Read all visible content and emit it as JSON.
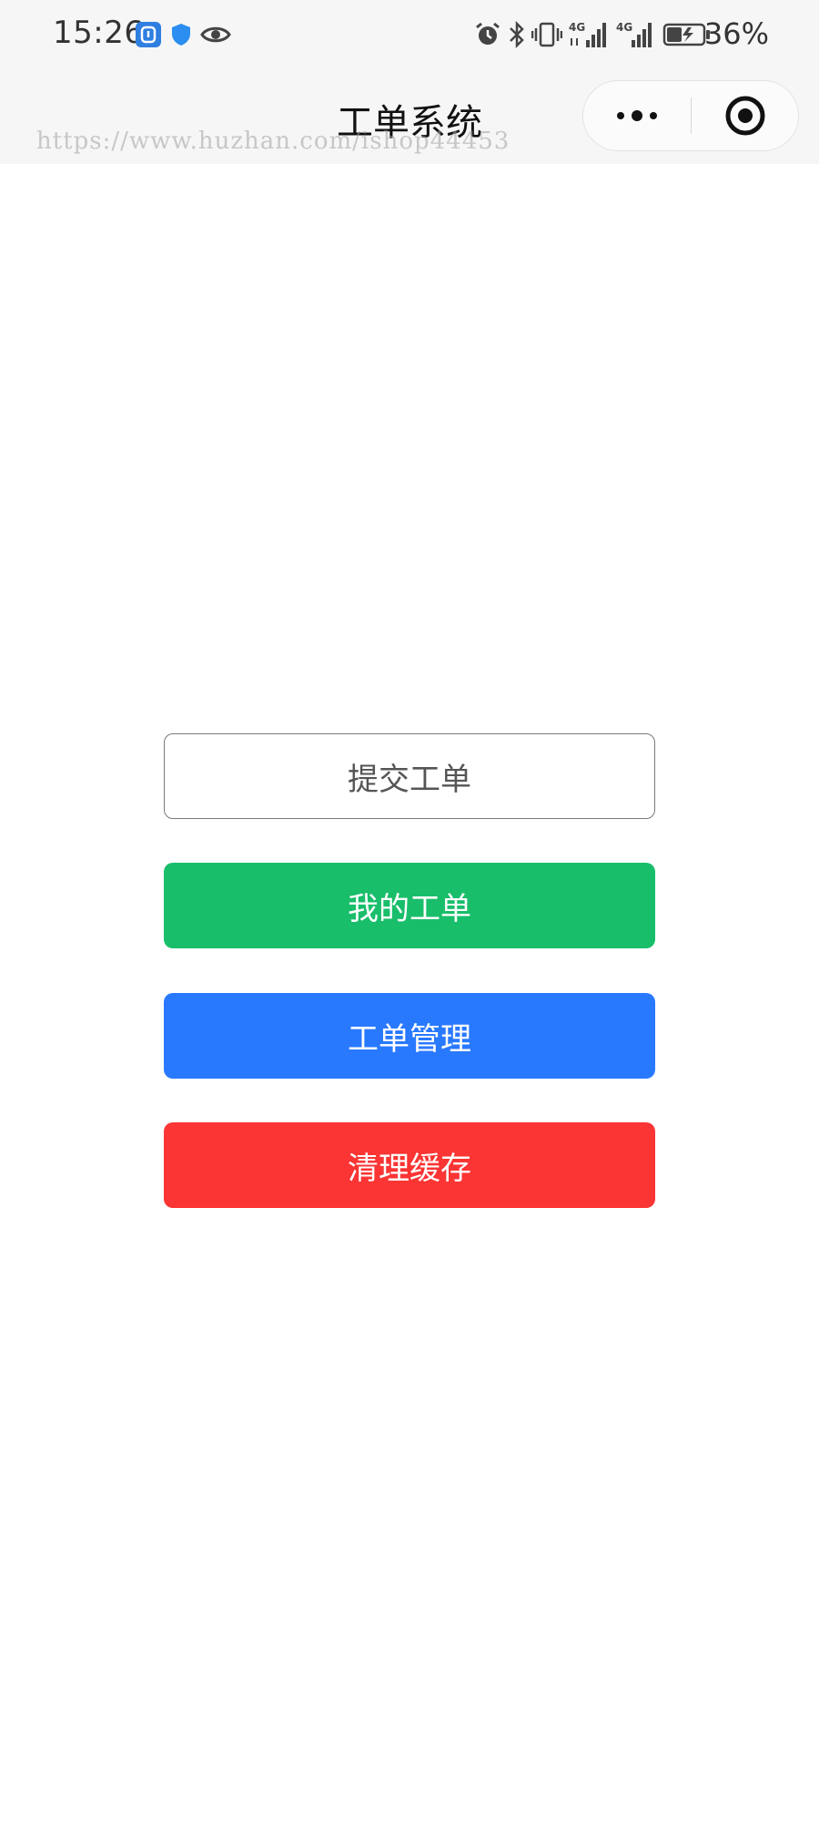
{
  "status_bar": {
    "time": "15:26",
    "battery_percent": "36%",
    "network_4g_1": "4G",
    "network_4g_2": "4G",
    "icons": [
      "app-notification-icon",
      "shield-icon",
      "eye-icon",
      "alarm-icon",
      "bluetooth-icon",
      "vibrate-icon",
      "signal-4g-icon",
      "signal-4g-icon",
      "battery-charging-icon"
    ]
  },
  "nav": {
    "title": "工单系统",
    "watermark": "https://www.huzhan.com/ishop44453"
  },
  "capsule": {
    "more_icon": "more-dots-icon",
    "close_icon": "target-circle-icon"
  },
  "buttons": {
    "submit": "提交工单",
    "mine": "我的工单",
    "manage": "工单管理",
    "clear": "清理缓存"
  },
  "colors": {
    "mine": "#19be6b",
    "manage": "#2979ff",
    "clear": "#fa3534",
    "submit_border": "#7a7a7a"
  }
}
